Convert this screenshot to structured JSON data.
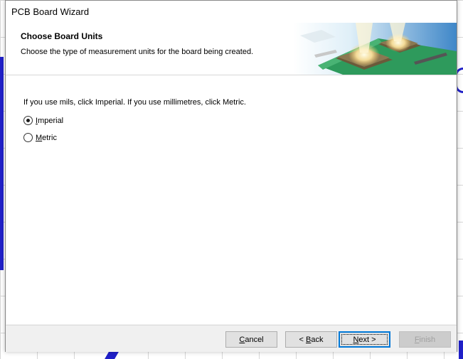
{
  "window": {
    "title": "PCB Board Wizard"
  },
  "header": {
    "title": "Choose Board Units",
    "subtitle": "Choose the type of measurement units for the board being created.",
    "art_icon": "pcb-chip-illustration"
  },
  "content": {
    "instruction": "If you use mils, click Imperial. If you use millimetres, click Metric.",
    "options": [
      {
        "label_mnemonic": "I",
        "label_rest": "mperial",
        "selected": true
      },
      {
        "label_mnemonic": "M",
        "label_rest": "etric",
        "selected": false
      }
    ]
  },
  "footer": {
    "cancel": {
      "mnemonic": "C",
      "rest": "ancel"
    },
    "back": {
      "prefix": "< ",
      "mnemonic": "B",
      "rest": "ack"
    },
    "next": {
      "mnemonic": "N",
      "rest": "ext >"
    },
    "finish": {
      "mnemonic": "F",
      "rest": "inish",
      "disabled": true
    }
  },
  "colors": {
    "accent": "#0078d7",
    "wire": "#2020c8",
    "pcb_green": "#2e9a5c"
  }
}
